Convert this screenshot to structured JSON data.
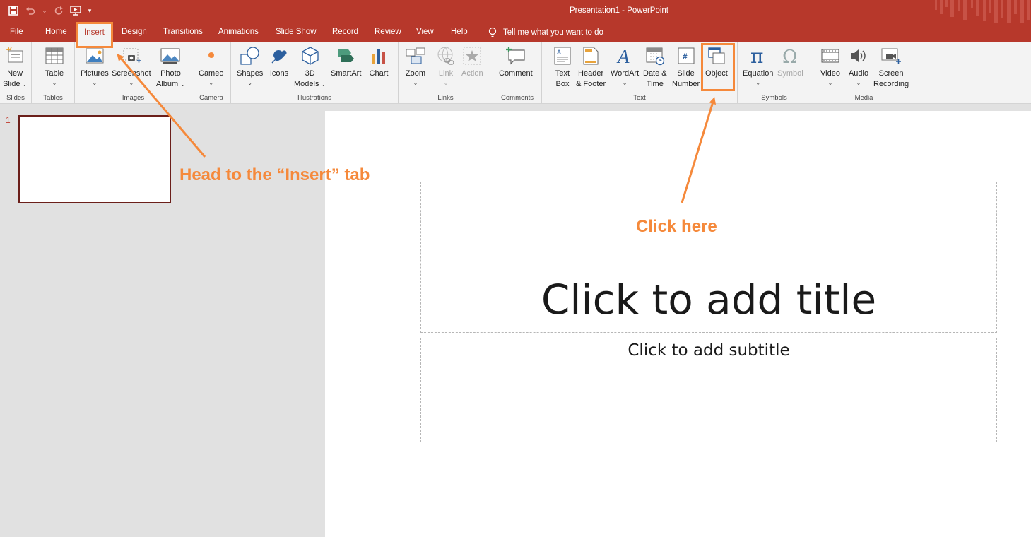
{
  "window": {
    "title": "Presentation1  -  PowerPoint"
  },
  "qat": {
    "save": "save-icon",
    "undo": "undo-icon",
    "redo": "redo-icon",
    "present": "present-icon",
    "customize": "customize-icon"
  },
  "tabs": [
    "File",
    "Home",
    "Insert",
    "Design",
    "Transitions",
    "Animations",
    "Slide Show",
    "Record",
    "Review",
    "View",
    "Help"
  ],
  "active_tab": "Insert",
  "tell_me": "Tell me what you want to do",
  "ribbon": {
    "groups": {
      "slides": "Slides",
      "tables": "Tables",
      "images": "Images",
      "camera": "Camera",
      "illustrations": "Illustrations",
      "links": "Links",
      "comments": "Comments",
      "text": "Text",
      "symbols": "Symbols",
      "media": "Media"
    },
    "cmd": {
      "new_slide_1": "New",
      "new_slide_2": "Slide",
      "table": "Table",
      "pictures": "Pictures",
      "screenshot": "Screenshot",
      "photo_album_1": "Photo",
      "photo_album_2": "Album",
      "cameo": "Cameo",
      "shapes": "Shapes",
      "icons": "Icons",
      "models_1": "3D",
      "models_2": "Models",
      "smartart": "SmartArt",
      "chart": "Chart",
      "zoom": "Zoom",
      "link": "Link",
      "action": "Action",
      "comment": "Comment",
      "textbox_1": "Text",
      "textbox_2": "Box",
      "header_1": "Header",
      "header_2": "& Footer",
      "wordart": "WordArt",
      "datetime_1": "Date &",
      "datetime_2": "Time",
      "slidenum_1": "Slide",
      "slidenum_2": "Number",
      "object": "Object",
      "equation": "Equation",
      "symbol": "Symbol",
      "video": "Video",
      "audio": "Audio",
      "screenrec_1": "Screen",
      "screenrec_2": "Recording"
    }
  },
  "thumbnails": {
    "slide_number": "1"
  },
  "slide": {
    "title_placeholder": "Click to add title",
    "subtitle_placeholder": "Click to add subtitle"
  },
  "annotations": {
    "insert_callout": "Head to the “Insert” tab",
    "object_callout": "Click here",
    "color": "#f5893b"
  },
  "colors": {
    "accent": "#b7382b",
    "ribbon": "#f3f3f3"
  }
}
